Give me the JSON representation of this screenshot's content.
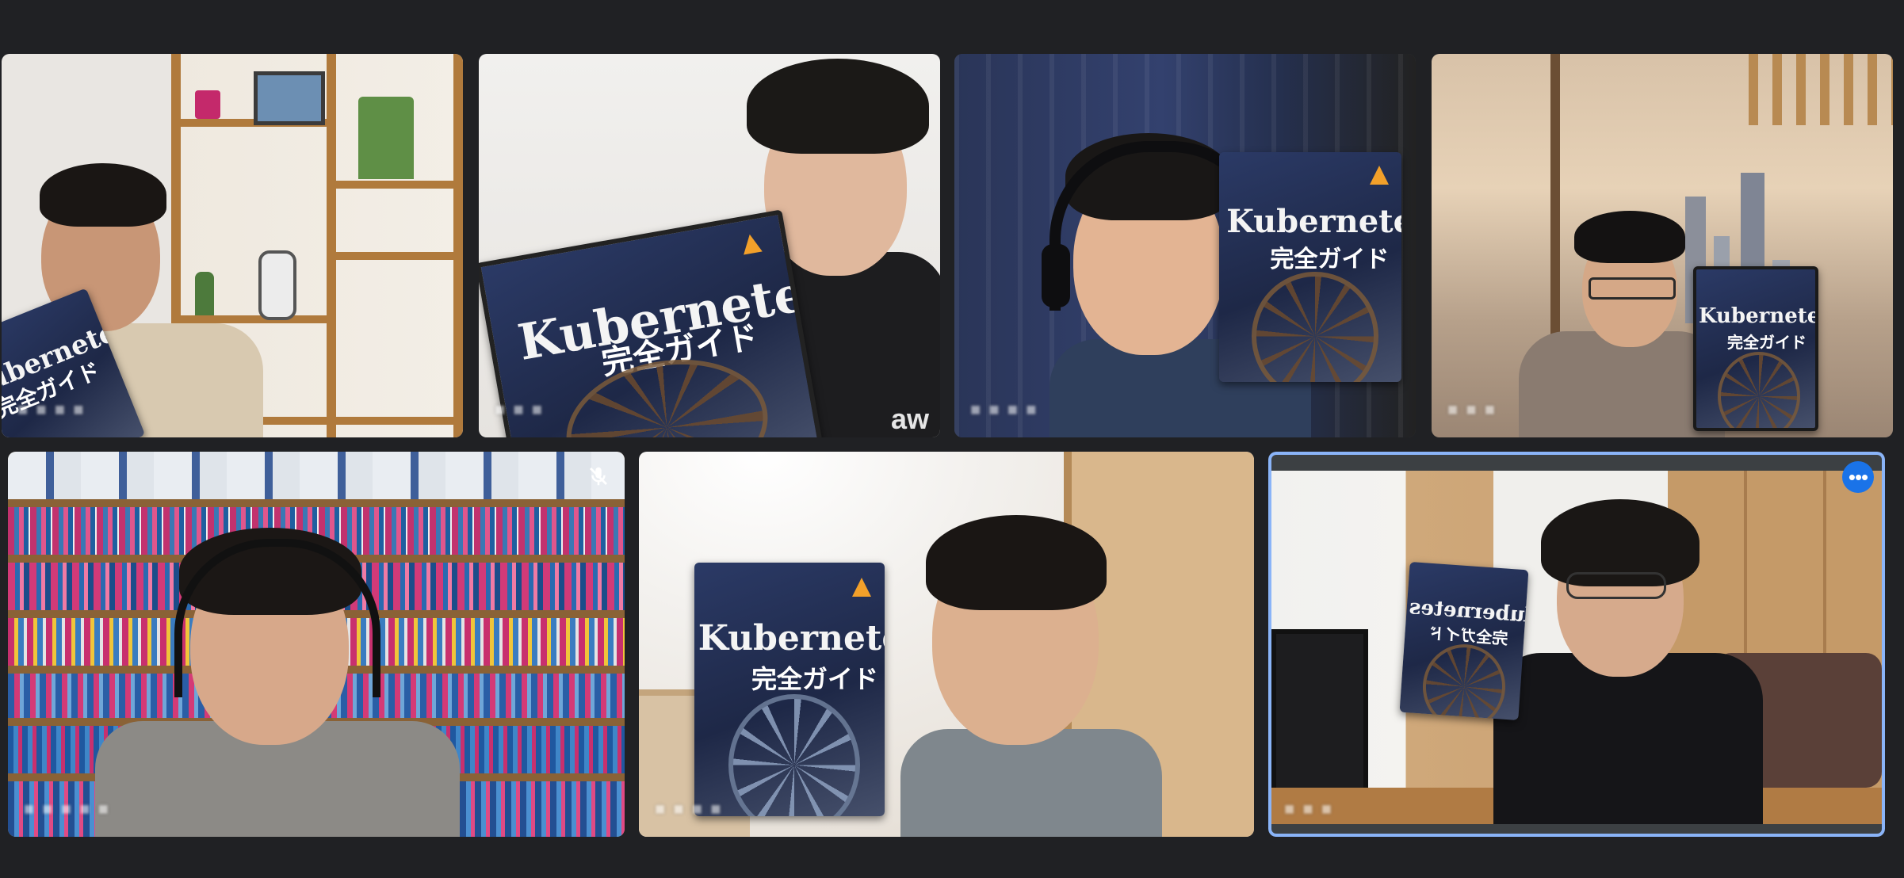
{
  "participants": [
    {
      "name": "■ ■ ■ ■",
      "book": {
        "title": "Kubernetes",
        "subtitle": "完全ガイド"
      }
    },
    {
      "name": "■ ■ ■",
      "book": {
        "title": "Kubernetes",
        "subtitle": "完全ガイド"
      }
    },
    {
      "name": "■ ■ ■ ■",
      "book": {
        "title": "Kubernetes",
        "subtitle": "完全ガイド"
      }
    },
    {
      "name": "■ ■ ■",
      "book": {
        "title": "Kubernetes",
        "subtitle": "完全ガイド"
      }
    },
    {
      "name": "■ ■ ■ ■ ■",
      "muted": true,
      "book": null
    },
    {
      "name": "■ ■ ■ ■",
      "book": {
        "title": "Kubernetes",
        "subtitle": "完全ガイド"
      }
    },
    {
      "name": "■ ■ ■",
      "active": true,
      "book": {
        "title": "Kubernetes",
        "subtitle": "完全ガイド"
      }
    }
  ],
  "hoodie_text": "aw",
  "active_tile_menu_label": "•••",
  "colors": {
    "background": "#202124",
    "active_border": "#8ab4f8",
    "menu_button": "#1a73e8",
    "book_accent": "#f2a02a"
  },
  "icons": [
    "more-options-icon",
    "mic-off-icon"
  ]
}
